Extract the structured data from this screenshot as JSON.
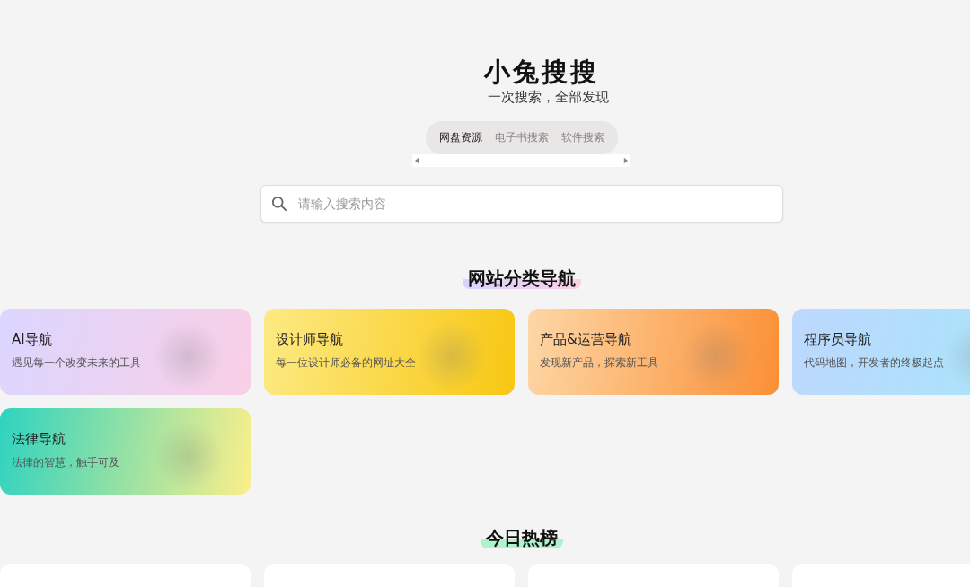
{
  "header": {
    "title": "小兔搜搜",
    "subtitle": "一次搜索，全部发现"
  },
  "tabs": [
    {
      "label": "网盘资源",
      "selected": true
    },
    {
      "label": "电子书搜索",
      "selected": false
    },
    {
      "label": "软件搜索",
      "selected": false
    }
  ],
  "search": {
    "placeholder": "请输入搜索内容"
  },
  "categories": {
    "title": "网站分类导航",
    "cards": [
      {
        "title": "AI导航",
        "description": "遇见每一个改变未来的工具",
        "kind": "lavender"
      },
      {
        "title": "设计师导航",
        "description": "每一位设计师必备的网址大全",
        "kind": "yellow"
      },
      {
        "title": "产品&运营导航",
        "description": "发现新产品，探索新工具",
        "kind": "orange"
      },
      {
        "title": "程序员导航",
        "description": "代码地图，开发者的终极起点",
        "kind": "sky"
      },
      {
        "title": "法律导航",
        "description": "法律的智慧，触手可及",
        "kind": "mint"
      }
    ]
  },
  "hot": {
    "title": "今日热榜"
  }
}
